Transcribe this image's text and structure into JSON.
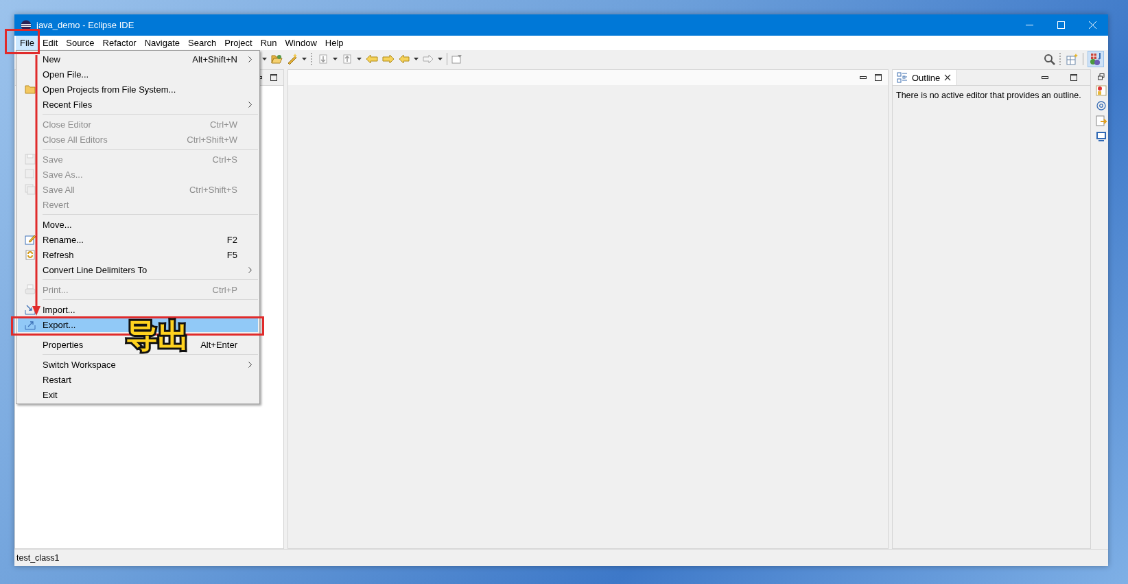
{
  "window": {
    "title": "java_demo - Eclipse IDE"
  },
  "menu_bar": [
    {
      "label": "File",
      "selected": true
    },
    {
      "label": "Edit",
      "selected": false
    },
    {
      "label": "Source",
      "selected": false
    },
    {
      "label": "Refactor",
      "selected": false
    },
    {
      "label": "Navigate",
      "selected": false
    },
    {
      "label": "Search",
      "selected": false
    },
    {
      "label": "Project",
      "selected": false
    },
    {
      "label": "Run",
      "selected": false
    },
    {
      "label": "Window",
      "selected": false
    },
    {
      "label": "Help",
      "selected": false
    }
  ],
  "file_menu": {
    "items": [
      {
        "kind": "item",
        "label": "New",
        "shortcut": "Alt+Shift+N",
        "submenu": true,
        "disabled": false,
        "selected": false
      },
      {
        "kind": "item",
        "label": "Open File...",
        "disabled": false,
        "selected": false
      },
      {
        "kind": "item",
        "label": "Open Projects from File System...",
        "disabled": false,
        "selected": false
      },
      {
        "kind": "item",
        "label": "Recent Files",
        "submenu": true,
        "disabled": false,
        "selected": false
      },
      {
        "kind": "separator"
      },
      {
        "kind": "item",
        "label": "Close Editor",
        "shortcut": "Ctrl+W",
        "disabled": true,
        "selected": false
      },
      {
        "kind": "item",
        "label": "Close All Editors",
        "shortcut": "Ctrl+Shift+W",
        "disabled": true,
        "selected": false
      },
      {
        "kind": "separator"
      },
      {
        "kind": "item",
        "label": "Save",
        "shortcut": "Ctrl+S",
        "disabled": true,
        "selected": false
      },
      {
        "kind": "item",
        "label": "Save As...",
        "disabled": true,
        "selected": false
      },
      {
        "kind": "item",
        "label": "Save All",
        "shortcut": "Ctrl+Shift+S",
        "disabled": true,
        "selected": false
      },
      {
        "kind": "item",
        "label": "Revert",
        "disabled": true,
        "selected": false
      },
      {
        "kind": "separator"
      },
      {
        "kind": "item",
        "label": "Move...",
        "disabled": false,
        "selected": false
      },
      {
        "kind": "item",
        "label": "Rename...",
        "shortcut": "F2",
        "disabled": false,
        "selected": false
      },
      {
        "kind": "item",
        "label": "Refresh",
        "shortcut": "F5",
        "disabled": false,
        "selected": false
      },
      {
        "kind": "item",
        "label": "Convert Line Delimiters To",
        "submenu": true,
        "disabled": false,
        "selected": false
      },
      {
        "kind": "separator"
      },
      {
        "kind": "item",
        "label": "Print...",
        "shortcut": "Ctrl+P",
        "disabled": true,
        "selected": false
      },
      {
        "kind": "separator"
      },
      {
        "kind": "item",
        "label": "Import...",
        "disabled": false,
        "selected": false
      },
      {
        "kind": "item",
        "label": "Export...",
        "disabled": false,
        "selected": true
      },
      {
        "kind": "separator"
      },
      {
        "kind": "item",
        "label": "Properties",
        "shortcut": "Alt+Enter",
        "disabled": false,
        "selected": false
      },
      {
        "kind": "separator"
      },
      {
        "kind": "item",
        "label": "Switch Workspace",
        "submenu": true,
        "disabled": false,
        "selected": false
      },
      {
        "kind": "item",
        "label": "Restart",
        "disabled": false,
        "selected": false
      },
      {
        "kind": "item",
        "label": "Exit",
        "disabled": false,
        "selected": false
      }
    ]
  },
  "outline_view": {
    "tab": "Outline",
    "message": "There is no active editor that provides an outline."
  },
  "status_bar": {
    "text": "test_class1"
  },
  "annotation": {
    "label": "导出"
  }
}
